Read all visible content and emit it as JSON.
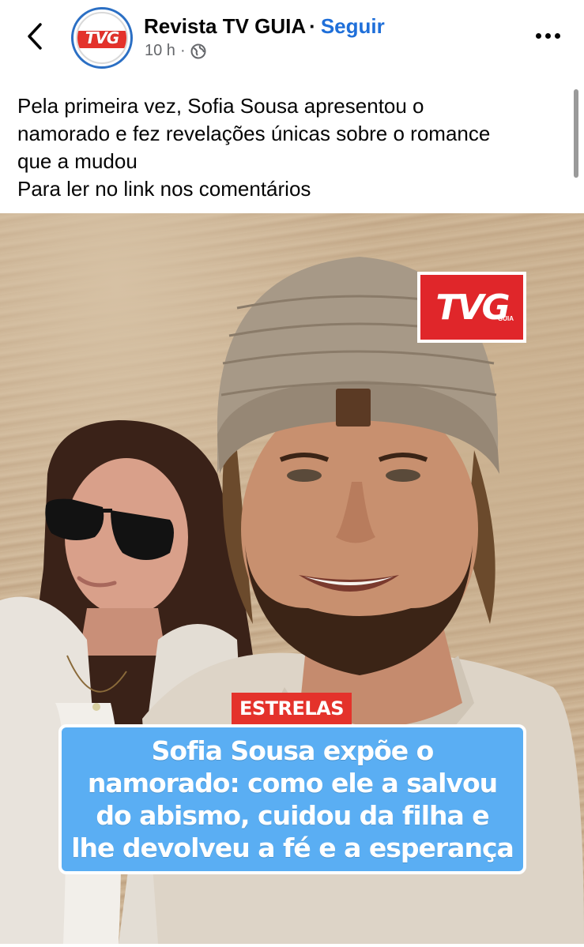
{
  "post": {
    "page_name": "Revista TV GUIA",
    "separator": "·",
    "follow_label": "Seguir",
    "time": "10 h",
    "meta_separator": "·",
    "avatar_text": "TVG",
    "caption_lines": [
      "Pela primeira vez, Sofia Sousa apresentou o",
      "namorado e fez revelações únicas sobre o romance",
      "que a mudou",
      "Para ler no link nos comentários"
    ]
  },
  "image": {
    "logo_text": "TVG",
    "logo_sub": "GUIA",
    "tag": "ESTRELAS",
    "headline_lines": [
      "Sofia Sousa expõe o",
      "namorado: como ele a salvou",
      "do abismo, cuidou da filha e",
      "lhe devolveu a fé e a esperança"
    ]
  },
  "icons": {
    "back": "chevron-left-icon",
    "audience": "globe-icon",
    "more": "more-horizontal-icon"
  },
  "colors": {
    "follow": "#1f6fd9",
    "tag_background": "#e4322b",
    "headline_background": "#5aaef3",
    "avatar_ring": "#2b6fc4"
  }
}
